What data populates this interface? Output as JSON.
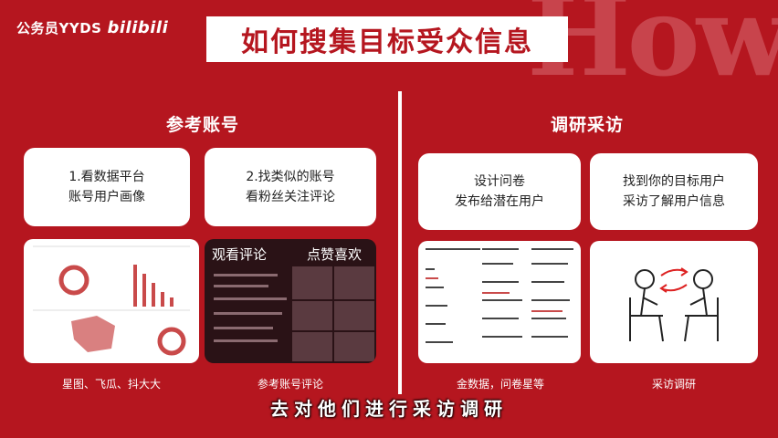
{
  "header": {
    "brand": "公务员YYDS",
    "brand_logo": "bilibili",
    "title": "如何搜集目标受众信息",
    "bg_word": "How"
  },
  "left_panel": {
    "title": "参考账号",
    "card1": {
      "line1": "1.看数据平台",
      "line2": "账号用户画像"
    },
    "card2": {
      "line1": "2.找类似的账号",
      "line2": "看粉丝关注评论"
    },
    "image2_labels": {
      "left": "观看评论",
      "right": "点赞喜欢"
    },
    "caption1": "星图、飞瓜、抖大大",
    "caption2": "参考账号评论"
  },
  "right_panel": {
    "title": "调研采访",
    "card1": {
      "line1": "设计问卷",
      "line2": "发布给潜在用户"
    },
    "card2": {
      "line1": "找到你的目标用户",
      "line2": "采访了解用户信息"
    },
    "caption1": "金数据，问卷星等",
    "caption2": "采访调研"
  },
  "subtitle": "去对他们进行采访调研",
  "colors": {
    "brand_red": "#b5161f",
    "white": "#ffffff"
  }
}
